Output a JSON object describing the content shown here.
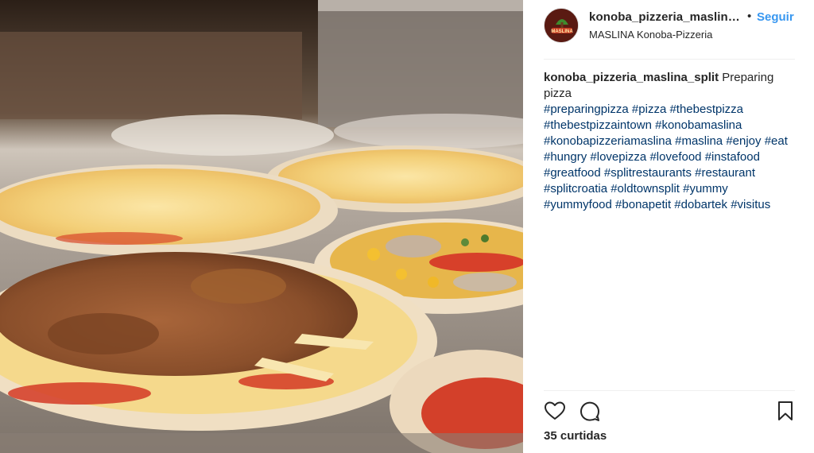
{
  "post": {
    "photo_description_icon": "pizza-photo",
    "author": {
      "username": "konoba_pizzeria_maslin…",
      "location": "MASLINA Konoba-Pizzeria",
      "avatar_text": "MASLINA"
    },
    "separator": "•",
    "follow_label": "Seguir",
    "caption": {
      "username": "konoba_pizzeria_maslina_split",
      "text": "Preparing pizza",
      "hashtags": [
        "#preparingpizza",
        "#pizza",
        "#thebestpizza",
        "#thebestpizzaintown",
        "#konobamaslina",
        "#konobapizzeriamaslina",
        "#maslina",
        "#enjoy",
        "#eat",
        "#hungry",
        "#lovepizza",
        "#lovefood",
        "#instafood",
        "#greatfood",
        "#splitrestaurants",
        "#restaurant",
        "#splitcroatia",
        "#oldtownsplit",
        "#yummy",
        "#yummyfood",
        "#bonapetit",
        "#dobartek",
        "#visitus"
      ]
    },
    "actions": {
      "like_icon": "heart-icon",
      "comment_icon": "comment-icon",
      "save_icon": "bookmark-icon"
    },
    "likes_text": "35 curtidas"
  },
  "colors": {
    "link_blue": "#3897f0",
    "hashtag_blue": "#003569",
    "text": "#262626",
    "divider": "#efefef"
  }
}
